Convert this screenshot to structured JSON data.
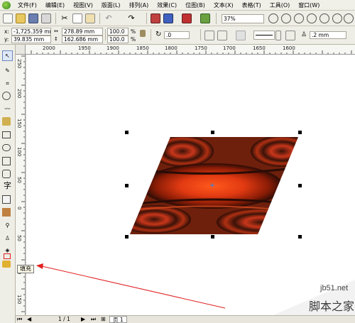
{
  "menu": {
    "items": [
      "文件(F)",
      "编辑(E)",
      "视图(V)",
      "版面(L)",
      "排列(A)",
      "效果(C)",
      "位图(B)",
      "文本(X)",
      "表格(T)",
      "工具(O)",
      "窗口(W)"
    ]
  },
  "toolbar": {
    "zoom_value": "37%"
  },
  "property_bar": {
    "x_label": "x:",
    "x_value": "-1,725.359 mm",
    "y_label": "y:",
    "y_value": "39.835 mm",
    "width_value": "278.89 mm",
    "height_value": "162.686 mm",
    "scale_x": "100.0",
    "scale_y": "100.0",
    "percent_x": "%",
    "percent_y": "%",
    "rotation_value": ".0",
    "outline_width": ".2 mm"
  },
  "ruler_top": {
    "labels": [
      "2000",
      "1950",
      "1900",
      "1850",
      "1800",
      "1750",
      "1700",
      "1650",
      "1600"
    ]
  },
  "ruler_left": {
    "labels": [
      "250",
      "200",
      "150",
      "100",
      "50",
      "0",
      "50",
      "100",
      "150"
    ]
  },
  "tooltip": {
    "text": "填充"
  },
  "status": {
    "page_count": "1 / 1",
    "page_tab": "页 1"
  },
  "watermark": {
    "site": "jb51.net",
    "brand": "脚本之家"
  },
  "colors": {
    "accent_red": "#e02020",
    "fill_dark": "#2a0c06",
    "fill_orange": "#e0441a"
  }
}
